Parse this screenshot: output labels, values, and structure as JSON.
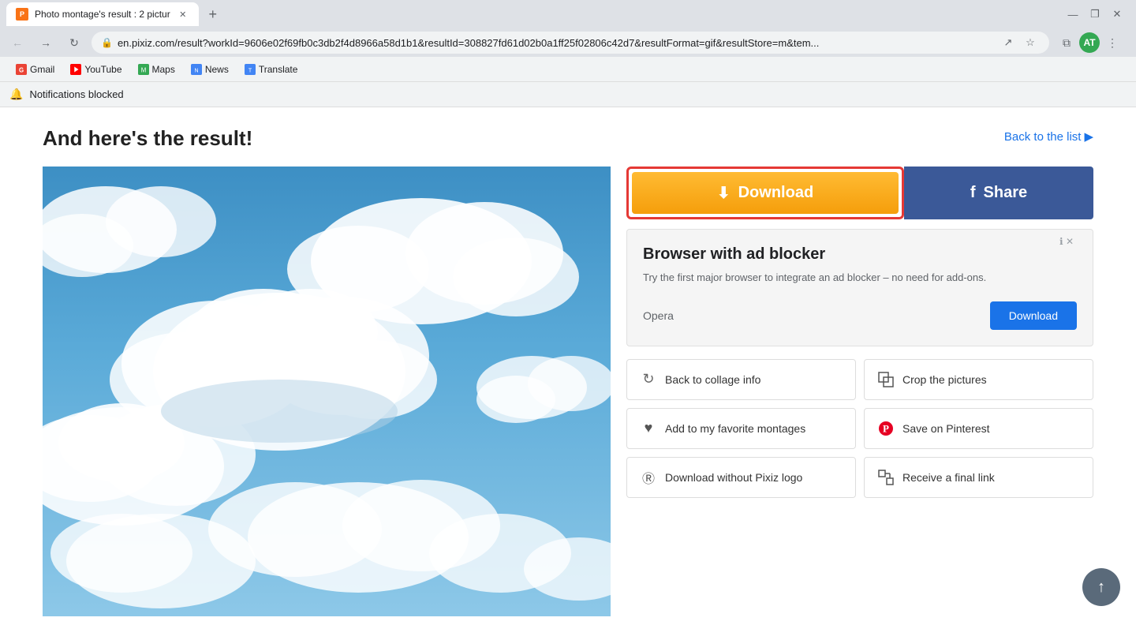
{
  "browser": {
    "tab": {
      "title": "Photo montage's result : 2 pictur",
      "favicon_text": "P"
    },
    "new_tab_label": "+",
    "window_controls": {
      "minimize": "—",
      "maximize": "❐",
      "close": "✕"
    },
    "address_bar": {
      "url": "en.pixiz.com/result?workId=9606e02f69fb0c3db2f4d8966a58d1b1&resultId=308827fd61d02b0a1ff25f02806c42d7&resultFormat=gif&resultStore=m&tem...",
      "lock_icon": "🔒"
    },
    "bookmarks": [
      {
        "label": "Gmail",
        "color": "#EA4335"
      },
      {
        "label": "YouTube",
        "color": "#FF0000"
      },
      {
        "label": "Maps",
        "color": "#34A853"
      },
      {
        "label": "News",
        "color": "#4285F4"
      },
      {
        "label": "Translate",
        "color": "#4285F4"
      }
    ],
    "notification": {
      "text": "Notifications blocked"
    },
    "profile_initial": "AT"
  },
  "page": {
    "title": "And here's the result!",
    "back_to_list": "Back to the list",
    "back_arrow": "▶",
    "download_button": "Download",
    "share_button": "Share",
    "facebook_icon": "f",
    "download_icon": "⬇",
    "ad": {
      "title": "Browser with ad blocker",
      "description": "Try the first major browser to integrate an ad blocker – no need for add-ons.",
      "brand": "Opera",
      "download_label": "Download"
    },
    "actions": [
      {
        "id": "back-to-collage",
        "icon": "↻",
        "label": "Back to collage info"
      },
      {
        "id": "crop-pictures",
        "icon": "⊞",
        "label": "Crop the pictures"
      },
      {
        "id": "favorite-montages",
        "icon": "♥",
        "label": "Add to my favorite montages"
      },
      {
        "id": "save-pinterest",
        "icon": "P",
        "label": "Save on Pinterest"
      },
      {
        "id": "download-no-logo",
        "icon": "Ⓡ",
        "label": "Download without Pixiz logo"
      },
      {
        "id": "receive-link",
        "icon": "⊟",
        "label": "Receive a final link"
      }
    ]
  }
}
